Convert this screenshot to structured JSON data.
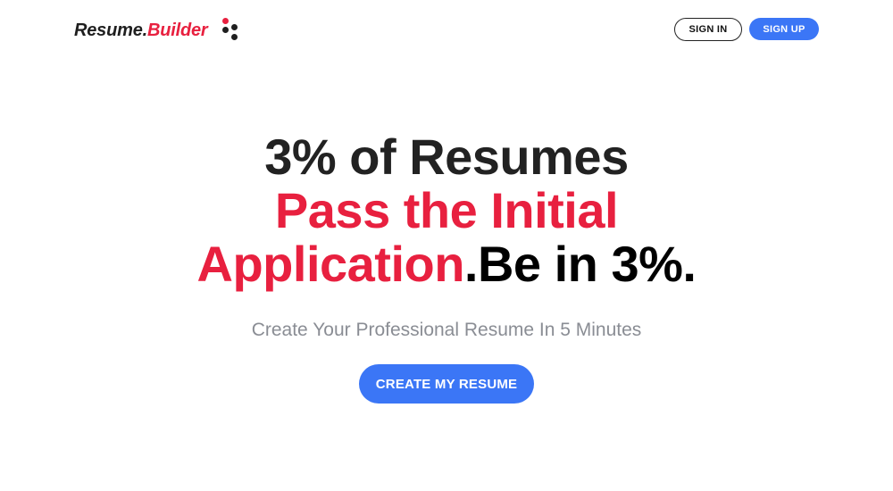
{
  "header": {
    "logo": {
      "part1": "Resume.",
      "part2": "Builder",
      "icon": "dots-logo-icon"
    },
    "sign_in_label": "SIGN IN",
    "sign_up_label": "SIGN UP"
  },
  "hero": {
    "line1": "3% of Resumes",
    "line2": "Pass the Initial",
    "line3_red": "Application",
    "line3_black": ".Be in 3%.",
    "subtitle": "Create Your Professional Resume In 5 Minutes",
    "cta_label": "CREATE MY RESUME"
  },
  "colors": {
    "accent_red": "#e8203f",
    "primary_blue": "#3b76f6",
    "text_dark": "#222222",
    "subtitle_gray": "#8a8d94"
  }
}
